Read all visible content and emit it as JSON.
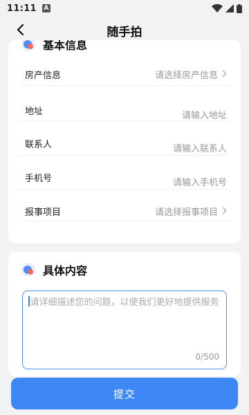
{
  "status_bar": {
    "time": "11:11",
    "notification_badge": "A"
  },
  "header": {
    "title": "随手拍"
  },
  "basic_info": {
    "title": "基本信息",
    "rows": [
      {
        "label": "房产信息",
        "value": "请选择房产信息",
        "has_chevron": true
      },
      {
        "label": "地址",
        "value": "请输入地址",
        "has_chevron": false
      },
      {
        "label": "联系人",
        "value": "请输入联系人",
        "has_chevron": false
      },
      {
        "label": "手机号",
        "value": "请输入手机号",
        "has_chevron": false
      },
      {
        "label": "报事项目",
        "value": "请选择报事项目",
        "has_chevron": true
      }
    ]
  },
  "details": {
    "title": "具体内容",
    "placeholder": "请详细描述您的问题，以便我们更好地提供服务",
    "counter": "0/500"
  },
  "submit": {
    "label": "提交"
  },
  "colors": {
    "accent": "#3d87f5",
    "page_bg": "#f1f2f4",
    "card_bg": "#ffffff"
  }
}
